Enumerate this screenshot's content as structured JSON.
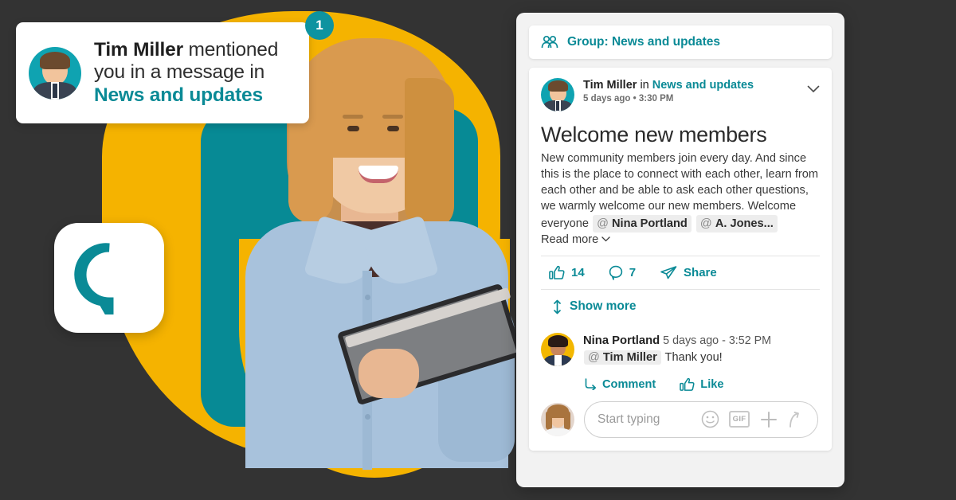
{
  "colors": {
    "background": "#333333",
    "teal": "#088A95",
    "teal_bright": "#0FA3B1",
    "yellow": "#F5B300",
    "panel_bg": "#F2F2F2",
    "card_bg": "#FFFFFF",
    "chip_bg": "#EDEDED"
  },
  "toast": {
    "badge_count": "1",
    "author": "Tim Miller",
    "text_middle": " mentioned you in a message in ",
    "group_link": "News and updates",
    "avatar_name": "tim-miller-avatar"
  },
  "logo": {
    "name": "speech-bubble-logo"
  },
  "panel": {
    "group_bar": {
      "icon": "group-people-icon",
      "label": "Group: News and updates"
    },
    "post": {
      "author": "Tim Miller",
      "connector": " in ",
      "group": "News and updates",
      "timestamp": "5 days ago • 3:30 PM",
      "menu_icon": "chevron-down-icon",
      "title": "Welcome new members",
      "body": "New community members join every day. And since this is the place to connect with each other, learn from each other and be able to ask each other questions, we warmly welcome our new members. Welcome everyone ",
      "mentions": [
        {
          "at": "@",
          "name": "Nina Portland"
        },
        {
          "at": "@",
          "name": "A. Jones..."
        }
      ],
      "read_more": "Read more",
      "actions": [
        {
          "icon": "thumbs-up-icon",
          "label": "14",
          "name": "like-count"
        },
        {
          "icon": "comment-bubble-icon",
          "label": "7",
          "name": "comment-count"
        },
        {
          "icon": "share-paper-plane-icon",
          "label": "Share",
          "name": "share"
        }
      ],
      "show_more": "Show more",
      "show_more_icon": "expand-vertical-icon"
    },
    "comment": {
      "author": "Nina Portland",
      "timestamp": "5 days ago - 3:52 PM",
      "mention_at": "@",
      "mention_name": "Tim Miller",
      "text": " Thank you!",
      "actions": [
        {
          "icon": "reply-arrow-icon",
          "label": "Comment",
          "name": "comment-reply"
        },
        {
          "icon": "thumbs-up-icon",
          "label": "Like",
          "name": "comment-like"
        }
      ]
    },
    "composer": {
      "placeholder": "Start typing",
      "avatar_name": "current-user-avatar",
      "icons": [
        {
          "name": "emoji-smiley-icon"
        },
        {
          "name": "gif-icon",
          "label": "GIF"
        },
        {
          "name": "plus-attach-icon"
        },
        {
          "name": "send-arrow-icon"
        }
      ]
    }
  }
}
